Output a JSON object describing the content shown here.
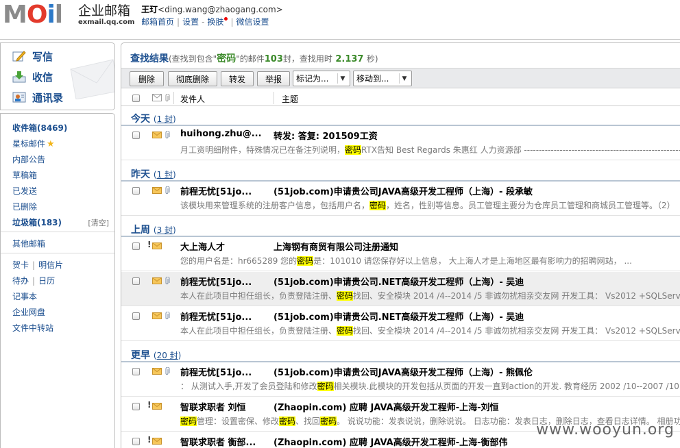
{
  "header": {
    "logo_letters": [
      "M",
      "O",
      "i",
      "l"
    ],
    "logo_cn": "企业邮箱",
    "logo_url": "exmail.qq.com",
    "user_name": "王玎",
    "user_email": "<ding.wang@zhaogang.com>",
    "links": [
      "邮箱首页",
      "设置",
      "换肤",
      "微信设置"
    ],
    "link_seps": [
      "|",
      "-",
      "|"
    ]
  },
  "sidebar": {
    "quick": [
      {
        "label": "写信",
        "icon": "pencil-icon"
      },
      {
        "label": "收信",
        "icon": "download-icon"
      },
      {
        "label": "通讯录",
        "icon": "contacts-icon"
      }
    ],
    "inbox": "收件箱(8469)",
    "starred": "星标邮件",
    "announce": "内部公告",
    "drafts": "草稿箱",
    "sent": "已发送",
    "deleted": "已删除",
    "spam": "垃圾箱(183)",
    "spam_clear": "[清空]",
    "other": "其他邮箱",
    "card": "贺卡",
    "postcard": "明信片",
    "todo": "待办",
    "calendar": "日历",
    "notes": "记事本",
    "disk": "企业网盘",
    "transfer": "文件中转站",
    "sep": "|"
  },
  "main": {
    "title": "查找结果",
    "desc_pre": "(查找到包含\"",
    "keyword": "密码",
    "desc_mid": "\"的邮件",
    "count": "103",
    "desc_unit": "封，查找用时",
    "time": "2.137",
    "desc_end": "秒)",
    "toolbar": {
      "delete": "删除",
      "perm_delete": "彻底删除",
      "forward": "转发",
      "report": "举报",
      "mark_as": "标记为...",
      "move_to": "移动到..."
    },
    "col_from": "发件人",
    "col_subject": "主题",
    "groups": [
      {
        "name": "今天",
        "count_pre": "(",
        "count": "1 封",
        "count_post": ")"
      },
      {
        "name": "昨天",
        "count_pre": "(",
        "count": "1 封",
        "count_post": ")"
      },
      {
        "name": "上周",
        "count_pre": "(",
        "count": "3 封",
        "count_post": ")"
      },
      {
        "name": "更早",
        "count_pre": "(",
        "count": "20 封",
        "count_post": ")"
      }
    ],
    "mails": [
      {
        "from": "huihong.zhu@...",
        "subject": "转发: 答复: 201509工资",
        "pre1": "月工资明细附件，特殊情况已在备注列说明，",
        "kw": "密码",
        "pre2": "RTX告知 Best Regards 朱惠红 人力资源部 ------------------------------------------------------------"
      },
      {
        "from": "前程无忧[51jo...",
        "subject": "(51job.com)申请贵公司JAVA高级开发工程师（上海）- 段承敏",
        "pre1": "该模块用来管理系统的注册客户信息，包括用户名，",
        "kw": "密码",
        "pre2": "，姓名，性别等信息。员工管理主要分为仓库员工管理和商城员工管理等。（2）"
      },
      {
        "from": "大上海人才",
        "subject": "上海钢有商贸有限公司注册通知",
        "flag": "!",
        "pre1": "您的用户名是：hr665289 您的",
        "kw": "密码",
        "pre2": "是：101010 请您保存好以上信息， 大上海人才是上海地区最有影响力的招聘网站， ..."
      },
      {
        "from": "前程无忧[51jo...",
        "subject": "(51job.com)申请贵公司.NET高级开发工程师（上海）- 吴迪",
        "pre1": "本人在此项目中担任组长，负责登陆注册、",
        "kw": "密码",
        "pre2": "找回、安全模块 2014 /4--2014 /5 非诚勿扰相亲交友网 开发工具： Vs2012 +SQLServer"
      },
      {
        "from": "前程无忧[51jo...",
        "subject": "(51job.com)申请贵公司.NET高级开发工程师（上海）- 吴迪",
        "pre1": "本人在此项目中担任组长，负责登陆注册、",
        "kw": "密码",
        "pre2": "找回、安全模块 2014 /4--2014 /5 非诚勿扰相亲交友网 开发工具： Vs2012 +SQLServer"
      },
      {
        "from": "前程无忧[51jo...",
        "subject": "(51job.com)申请贵公司JAVA高级开发工程师（上海）- 熊佩伦",
        "pre1": "： 从测试入手,开发了会员登陆和修改",
        "kw": "密码",
        "pre2": "相关模块.此模块的开发包括从页面的开发一直到action的开发. 教育经历 2002 /10--2007 /10"
      },
      {
        "from": "智联求职者 刘恒",
        "subject": "(Zhaopin.com) 应聘 JAVA高级开发工程师-上海-刘恒",
        "flag": "!",
        "pre0": "",
        "kw0": "密码",
        "pre1": "管理：设置密保、修改",
        "kw": "密码",
        "pre2": "、找回",
        "kw2": "密码",
        "pre3": "。 说说功能：发表说说，删除说说。 日志功能：发表日志，删除日志，查看日志详情。 相册功能"
      },
      {
        "from": "智联求职者 衡部...",
        "subject": "(Zhaopin.com) 应聘 JAVA高级开发工程师-上海-衡部伟",
        "flag": "!",
        "pre1": "",
        "kw": "",
        "pre2": ""
      }
    ]
  },
  "watermark": "www.wooyun.org",
  "colors": {
    "link_blue": "#1c4f8f",
    "green": "#3b8a2a",
    "highlight": "#ffff00",
    "toolbar_bg": "#e9eaec"
  }
}
